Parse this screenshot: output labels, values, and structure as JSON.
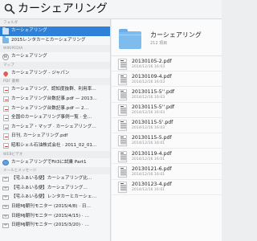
{
  "search": {
    "query": "カーシェアリング"
  },
  "sidebar": {
    "sections": [
      {
        "header": "フォルダ",
        "items": [
          {
            "label": "カーシェアリング",
            "icon": "folder-icon",
            "selected": true
          },
          {
            "label": "2015レンタカーとカーシェアリング",
            "icon": "folder-icon"
          }
        ]
      },
      {
        "header": "WIKIPEDIA",
        "items": [
          {
            "label": "カーシェアリング",
            "icon": "wikipedia-icon"
          }
        ]
      },
      {
        "header": "マップ",
        "items": [
          {
            "label": "カーシェアリング - ジャパン",
            "icon": "map-pin-icon"
          }
        ]
      },
      {
        "header": "PDF 書類",
        "items": [
          {
            "label": "カーシェアリング、認知度抜群、利用率…",
            "icon": "pdf-icon"
          },
          {
            "label": "カーシェアリング台数記事.pdf — 2013…",
            "icon": "pdf-icon"
          },
          {
            "label": "カーシェアリング台数記事.pdf — 2…",
            "icon": "pdf-icon"
          },
          {
            "label": "全国のカーシェアリング事例一覧 · 全…",
            "icon": "pdf-icon"
          },
          {
            "label": "カーシェア・マップ · カーシェアリング…",
            "icon": "pdf-icon"
          },
          {
            "label": "日刊, カーシェアリング.pdf",
            "icon": "pdf-icon"
          },
          {
            "label": "昭和シェル石油株式会社 · 2011_02_01…",
            "icon": "pdf-icon"
          }
        ]
      },
      {
        "header": "WEBビデオ",
        "items": [
          {
            "label": "カーシェアリングでFit3に試乗 Part1",
            "icon": "web-video-icon"
          }
        ]
      },
      {
        "header": "メールとメッセージ",
        "items": [
          {
            "label": "【宅ふぁいる便】カーシェアリング比…",
            "icon": "mail-icon"
          },
          {
            "label": "【宅ふぁいる便】カーシェアリング…",
            "icon": "mail-icon"
          },
          {
            "label": "【宅ふぁいる便】レンタカーとカーシェ…",
            "icon": "mail-icon"
          },
          {
            "label": "日経MJ朝刊モニター (2015/4/8) · 日…",
            "icon": "mail-icon"
          },
          {
            "label": "日経MJ朝刊モニター (2015/4/15) · …",
            "icon": "mail-icon"
          },
          {
            "label": "日経MJ朝刊モニター (2015/3/20) · …",
            "icon": "mail-icon"
          }
        ]
      }
    ]
  },
  "preview": {
    "folder_name": "カーシェアリング",
    "item_count": "212 項目",
    "files": [
      {
        "name": "20130105-2.pdf",
        "date": "2014/12/16 16:03"
      },
      {
        "name": "20130109-4.pdf",
        "date": "2014/12/16 16:03"
      },
      {
        "name": "20130115-5''.pdf",
        "date": "2014/12/16 16:03"
      },
      {
        "name": "20130115-5''.pdf",
        "date": "2014/12/16 16:03"
      },
      {
        "name": "20130115-5'.pdf",
        "date": "2014/12/16 16:03"
      },
      {
        "name": "20130115-5.pdf",
        "date": "2014/12/16 16:01"
      },
      {
        "name": "20130119-4.pdf",
        "date": "2014/12/16 16:01"
      },
      {
        "name": "20130121-6.pdf",
        "date": "2014/12/16 16:01"
      },
      {
        "name": "20130123-4.pdf",
        "date": "2014/12/16 16:01"
      }
    ]
  }
}
